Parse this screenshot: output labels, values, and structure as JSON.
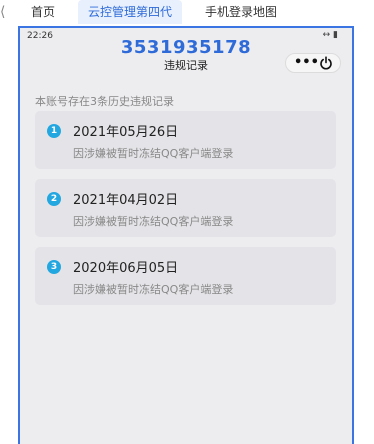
{
  "tabbar": {
    "tabs": [
      {
        "label": "首页"
      },
      {
        "label": "云控管理第四代"
      },
      {
        "label": "手机登录地图"
      }
    ]
  },
  "status": {
    "time": "22:26",
    "icons": "↔ ▮"
  },
  "header": {
    "account": "3531935178",
    "title": "违规记录",
    "more_label": "•••"
  },
  "summary": "本账号存在3条历史违规记录",
  "records": [
    {
      "index": "1",
      "date": "2021年05月26日",
      "desc": "因涉嫌被暂时冻结QQ客户端登录"
    },
    {
      "index": "2",
      "date": "2021年04月02日",
      "desc": "因涉嫌被暂时冻结QQ客户端登录"
    },
    {
      "index": "3",
      "date": "2020年06月05日",
      "desc": "因涉嫌被暂时冻结QQ客户端登录"
    }
  ],
  "colors": {
    "accent": "#2f6bd8",
    "badge": "#23a7e0",
    "frame": "#3b74e3"
  }
}
